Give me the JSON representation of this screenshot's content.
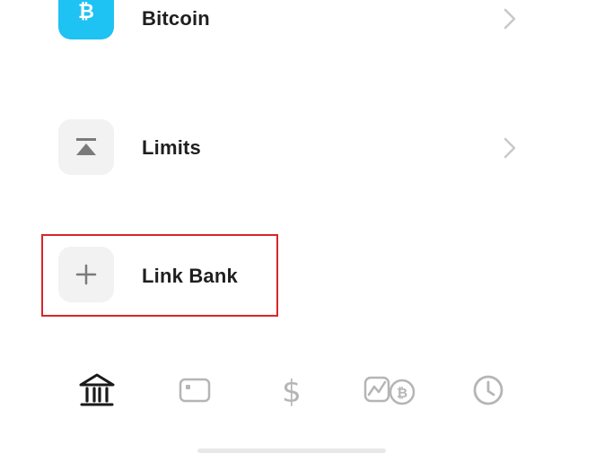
{
  "menu": {
    "items": [
      {
        "label": "Bitcoin",
        "icon": "bitcoin-icon",
        "icon_color": "#1ec2f3",
        "glyph": "₿"
      },
      {
        "label": "Limits",
        "icon": "limits-icon",
        "icon_color": "#f2f2f2"
      },
      {
        "label": "Link Bank",
        "icon": "plus-icon",
        "icon_color": "#f2f2f2"
      }
    ]
  },
  "highlight": {
    "color": "#d7262b"
  },
  "tabbar": {
    "tabs": [
      {
        "icon": "bank-icon",
        "active": true
      },
      {
        "icon": "card-icon",
        "active": false
      },
      {
        "icon": "dollar-icon",
        "active": false
      },
      {
        "icon": "investing-icon",
        "active": false
      },
      {
        "icon": "clock-icon",
        "active": false
      }
    ],
    "active_color": "#1a1a1a",
    "inactive_color": "#b5b5b5"
  }
}
